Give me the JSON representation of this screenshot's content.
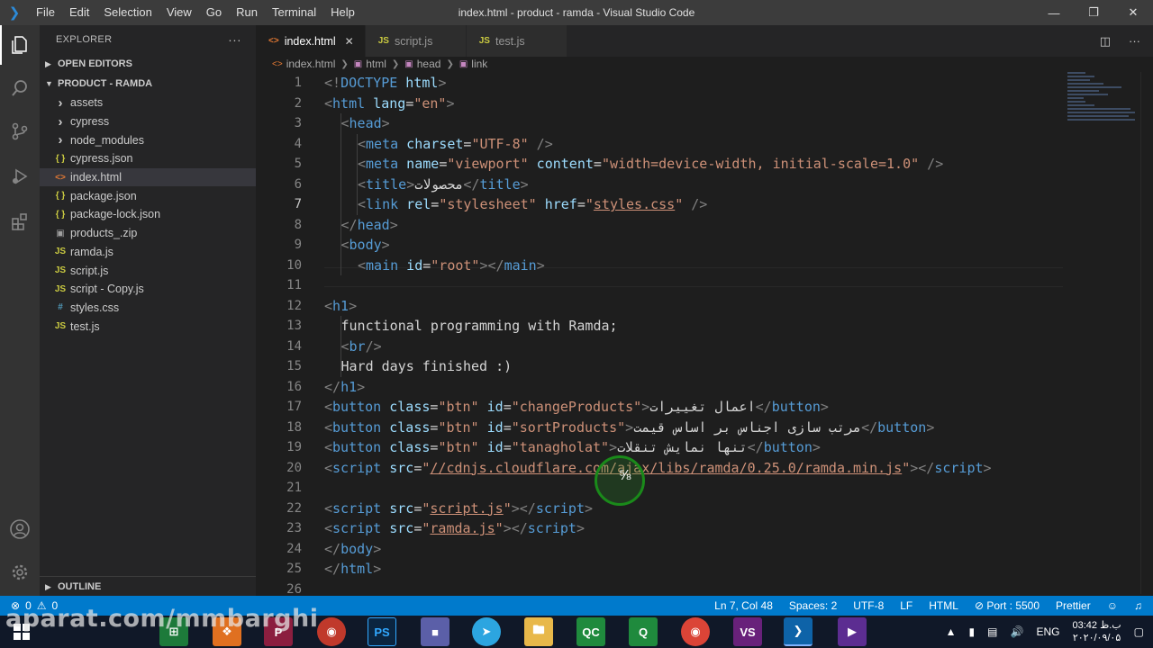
{
  "titlebar": {
    "menu": [
      "File",
      "Edit",
      "Selection",
      "View",
      "Go",
      "Run",
      "Terminal",
      "Help"
    ],
    "title": "index.html - product - ramda - Visual Studio Code"
  },
  "sidebar": {
    "explorer_label": "EXPLORER",
    "open_editors_label": "OPEN EDITORS",
    "project_label": "PRODUCT - RAMDA",
    "items": [
      {
        "label": "assets",
        "type": "folder"
      },
      {
        "label": "cypress",
        "type": "folder"
      },
      {
        "label": "node_modules",
        "type": "folder"
      },
      {
        "label": "cypress.json",
        "type": "json"
      },
      {
        "label": "index.html",
        "type": "html"
      },
      {
        "label": "package.json",
        "type": "json"
      },
      {
        "label": "package-lock.json",
        "type": "json"
      },
      {
        "label": "products_.zip",
        "type": "zip"
      },
      {
        "label": "ramda.js",
        "type": "js"
      },
      {
        "label": "script.js",
        "type": "js"
      },
      {
        "label": "script - Copy.js",
        "type": "js"
      },
      {
        "label": "styles.css",
        "type": "css"
      },
      {
        "label": "test.js",
        "type": "js"
      }
    ],
    "outline_label": "OUTLINE"
  },
  "tabs": [
    {
      "label": "index.html",
      "type": "html",
      "active": true
    },
    {
      "label": "script.js",
      "type": "js",
      "active": false
    },
    {
      "label": "test.js",
      "type": "js",
      "active": false
    }
  ],
  "breadcrumb": [
    "index.html",
    "html",
    "head",
    "link"
  ],
  "editor": {
    "current_line": 7,
    "line_numbers": [
      "1",
      "2",
      "3",
      "4",
      "5",
      "6",
      "7",
      "8",
      "9",
      "10",
      "11",
      "12",
      "13",
      "14",
      "15",
      "16",
      "17",
      "18",
      "19",
      "20",
      "21",
      "22",
      "23",
      "24",
      "25",
      "26"
    ]
  },
  "code": {
    "l1": [
      "<!",
      "DOCTYPE",
      " html",
      ">"
    ],
    "l2": [
      "<",
      "html",
      " lang",
      "=",
      "\"en\"",
      ">"
    ],
    "l3": [
      "<",
      "head",
      ">"
    ],
    "l4": [
      "<",
      "meta",
      " charset",
      "=",
      "\"UTF-8\"",
      " />"
    ],
    "l5": [
      "<",
      "meta",
      " name",
      "=",
      "\"viewport\"",
      " content",
      "=",
      "\"width=device-width, initial-scale=1.0\"",
      " />"
    ],
    "l6": [
      "<",
      "title",
      ">",
      "محصولات",
      "</",
      "title",
      ">"
    ],
    "l7": [
      "<",
      "link",
      " rel",
      "=",
      "\"stylesheet\"",
      " href",
      "=",
      "\"",
      "styles.css",
      "\"",
      " />"
    ],
    "l8": [
      "</",
      "head",
      ">"
    ],
    "l9": [
      "<",
      "body",
      ">"
    ],
    "l10": [
      "<",
      "main",
      " id",
      "=",
      "\"root\"",
      "></",
      "main",
      ">"
    ],
    "l12": [
      "<",
      "h1",
      ">"
    ],
    "l13": "functional programming with Ramda;",
    "l14": [
      "<",
      "br",
      "/>"
    ],
    "l15": "Hard days finished :)",
    "l16": [
      "</",
      "h1",
      ">"
    ],
    "l17": [
      "<",
      "button",
      " class",
      "=",
      "\"btn\"",
      " id",
      "=",
      "\"changeProducts\"",
      ">",
      "اعمال تغییرات",
      "</",
      "button",
      ">"
    ],
    "l18": [
      "<",
      "button",
      " class",
      "=",
      "\"btn\"",
      " id",
      "=",
      "\"sortProducts\"",
      ">",
      "مرتب سازی اجناس بر اساس قیمت",
      "</",
      "button",
      ">"
    ],
    "l19": [
      "<",
      "button",
      " class",
      "=",
      "\"btn\"",
      " id",
      "=",
      "\"tanagholat\"",
      ">",
      "تنها نمایش تنقلات",
      "</",
      "button",
      ">"
    ],
    "l20": [
      "<",
      "script",
      " src",
      "=",
      "\"",
      "//cdnjs.cloudflare.com/ajax/libs/ramda/0.25.0/ramda.min.js",
      "\"",
      "></",
      "script",
      ">"
    ],
    "l22": [
      "<",
      "script",
      " src",
      "=",
      "\"",
      "script.js",
      "\"",
      "></",
      "script",
      ">"
    ],
    "l23": [
      "<",
      "script",
      " src",
      "=",
      "\"",
      "ramda.js",
      "\"",
      "></",
      "script",
      ">"
    ],
    "l24": [
      "</",
      "body",
      ">"
    ],
    "l25": [
      "</",
      "html",
      ">"
    ]
  },
  "statusbar": {
    "errors": "0",
    "warnings": "0",
    "position": "Ln 7, Col 48",
    "spaces": "Spaces: 2",
    "encoding": "UTF-8",
    "eol": "LF",
    "language": "HTML",
    "port": "Port : 5500",
    "formatter": "Prettier"
  },
  "taskbar": {
    "watermark": "aparat.com/mmbarghi",
    "apps": [
      "PS",
      "QC",
      "VS",
      "VSCode"
    ],
    "lang": "ENG",
    "time": "03:42 ب.ظ",
    "date": "۲۰۲۰/۰۹/۰۵"
  },
  "colors": {
    "statusbar": "#007acc",
    "tag": "#569cd6",
    "attr": "#9cdcfe",
    "string": "#ce9178"
  }
}
